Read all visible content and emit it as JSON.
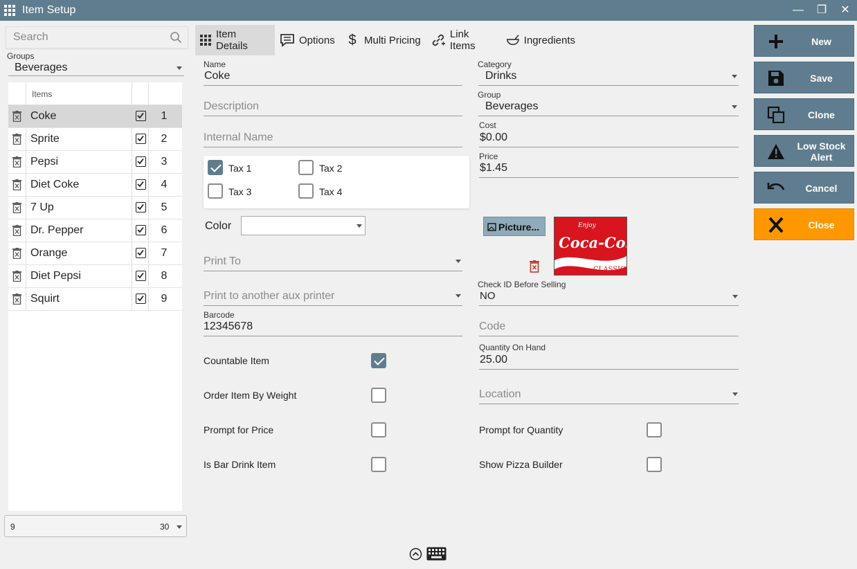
{
  "window": {
    "title": "Item Setup",
    "minimize": "—",
    "restore": "❐",
    "close": "✕"
  },
  "left": {
    "search_placeholder": "Search",
    "groups_label": "Groups",
    "groups_value": "Beverages",
    "items_header": "Items",
    "items": [
      {
        "name": "Coke",
        "checked": true,
        "order": "1"
      },
      {
        "name": "Sprite",
        "checked": true,
        "order": "2"
      },
      {
        "name": "Pepsi",
        "checked": true,
        "order": "3"
      },
      {
        "name": "Diet Coke",
        "checked": true,
        "order": "4"
      },
      {
        "name": "7 Up",
        "checked": true,
        "order": "5"
      },
      {
        "name": "Dr. Pepper",
        "checked": true,
        "order": "6"
      },
      {
        "name": "Orange",
        "checked": true,
        "order": "7"
      },
      {
        "name": "Diet Pepsi",
        "checked": true,
        "order": "8"
      },
      {
        "name": "Squirt",
        "checked": true,
        "order": "9"
      }
    ],
    "pager_count": "9",
    "pager_size": "30"
  },
  "tabs": [
    {
      "label": "Item Details",
      "icon": "grid-icon",
      "active": true
    },
    {
      "label": "Options",
      "icon": "chat-options-icon",
      "active": false
    },
    {
      "label": "Multi Pricing",
      "icon": "dollar-icon",
      "active": false
    },
    {
      "label": "Link Items",
      "icon": "link-add-icon",
      "active": false
    },
    {
      "label": "Ingredients",
      "icon": "bowl-icon",
      "active": false
    }
  ],
  "details": {
    "name_label": "Name",
    "name_value": "Coke",
    "description_placeholder": "Description",
    "internal_name_placeholder": "Internal Name",
    "taxes": [
      {
        "label": "Tax 1",
        "checked": true
      },
      {
        "label": "Tax 2",
        "checked": false
      },
      {
        "label": "Tax 3",
        "checked": false
      },
      {
        "label": "Tax 4",
        "checked": false
      }
    ],
    "color_label": "Color",
    "print_to_placeholder": "Print To",
    "print_aux_placeholder": "Print to another aux printer",
    "barcode_label": "Barcode",
    "barcode_value": "12345678",
    "countable_label": "Countable Item",
    "countable_checked": true,
    "order_weight_label": "Order Item By Weight",
    "prompt_price_label": "Prompt for Price",
    "bar_drink_label": "Is Bar Drink Item",
    "category_label": "Category",
    "category_value": "Drinks",
    "group_label": "Group",
    "group_value": "Beverages",
    "cost_label": "Cost",
    "cost_value": "$0.00",
    "price_label": "Price",
    "price_value": "$1.45",
    "picture_button": "Picture...",
    "check_id_label": "Check ID Before Selling",
    "check_id_value": "NO",
    "code_placeholder": "Code",
    "qty_label": "Quantity On Hand",
    "qty_value": "25.00",
    "location_placeholder": "Location",
    "prompt_qty_label": "Prompt for Quantity",
    "pizza_label": "Show Pizza Builder"
  },
  "actions": {
    "new": "New",
    "save": "Save",
    "clone": "Clone",
    "low_stock": "Low Stock Alert",
    "cancel": "Cancel",
    "close": "Close"
  },
  "picture_text": {
    "enjoy": "Enjoy",
    "brand": "Coca-Cola",
    "classic": "CLASSIC"
  },
  "colors": {
    "accent": "#5f7d8e",
    "close": "#ff9800",
    "delete": "#c0392b"
  }
}
